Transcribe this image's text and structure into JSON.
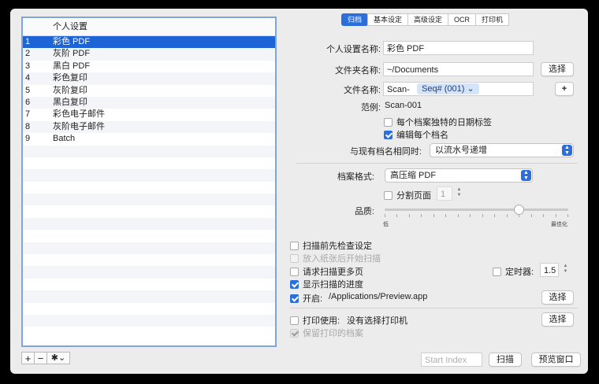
{
  "tabs": [
    {
      "label": "归档",
      "active": true
    },
    {
      "label": "基本设定",
      "active": false
    },
    {
      "label": "高级设定",
      "active": false
    },
    {
      "label": "OCR",
      "active": false
    },
    {
      "label": "打印机",
      "active": false
    }
  ],
  "profile_list": {
    "header": "个人设置",
    "items": [
      {
        "num": "1",
        "name": "彩色 PDF"
      },
      {
        "num": "2",
        "name": "灰阶 PDF"
      },
      {
        "num": "3",
        "name": "黑白 PDF"
      },
      {
        "num": "4",
        "name": "彩色复印"
      },
      {
        "num": "5",
        "name": "灰阶复印"
      },
      {
        "num": "6",
        "name": "黑白复印"
      },
      {
        "num": "7",
        "name": "彩色电子邮件"
      },
      {
        "num": "8",
        "name": "灰阶电子邮件"
      },
      {
        "num": "9",
        "name": "Batch"
      }
    ],
    "selected_index": 0
  },
  "list_tools": {
    "add": "+",
    "remove": "−",
    "gear": "✱⌄"
  },
  "form": {
    "profile_name_label": "个人设置名称:",
    "profile_name_value": "彩色 PDF",
    "folder_label": "文件夹名称:",
    "folder_value": "~/Documents",
    "choose_label": "选择",
    "filename_label": "文件名称:",
    "filename_prefix": "Scan-",
    "filename_token": "Seq# (001) ⌄",
    "plus": "+",
    "example_label": "范例:",
    "example_value": "Scan-001",
    "unique_date_label": "每个档案独特的日期标签",
    "unique_date_checked": false,
    "edit_each_label": "编辑每个档名",
    "edit_each_checked": true,
    "conflict_label": "与现有档名相同时:",
    "conflict_value": "以流水号递增",
    "format_label": "档案格式:",
    "format_value": "高压缩 PDF",
    "split_label": "分割页面",
    "split_checked": false,
    "split_value": "1",
    "quality_label": "品质:",
    "quality_low": "低",
    "quality_best": "最佳化",
    "quality_level": 0.73,
    "check_before_label": "扫描前先检查设定",
    "check_before_checked": false,
    "load_paper_label": "放入纸张后开始扫描",
    "load_paper_checked": false,
    "more_pages_label": "请求扫描更多页",
    "more_pages_checked": false,
    "timer_label": "定时器:",
    "timer_checked": false,
    "timer_value": "1.5",
    "show_progress_label": "显示扫描的进度",
    "show_progress_checked": true,
    "open_label": "开启:",
    "open_checked": true,
    "open_value": "/Applications/Preview.app",
    "open_choose": "选择",
    "print_label": "打印使用:",
    "print_checked": false,
    "print_value": "没有选择打印机",
    "print_choose": "选择",
    "keep_print_label": "保留打印的档案",
    "keep_print_checked": true
  },
  "footer": {
    "start_index_placeholder": "Start Index",
    "scan_button": "扫描",
    "preview_button": "预览窗口"
  },
  "colors": {
    "accent": "#2a6fdb",
    "selection": "#1d64d6"
  }
}
